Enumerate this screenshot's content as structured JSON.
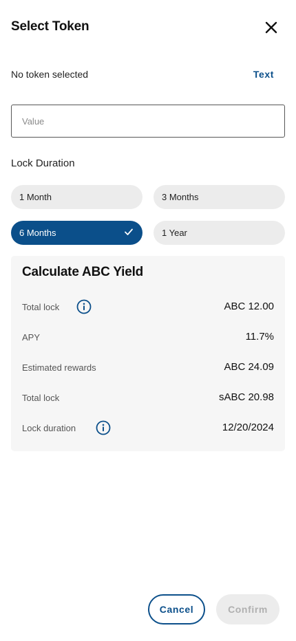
{
  "header": {
    "title": "Select Token",
    "close_icon": "close-icon"
  },
  "token": {
    "status": "No token selected",
    "link_label": "Text"
  },
  "value_input": {
    "placeholder": "Value",
    "value": ""
  },
  "lock_duration": {
    "label": "Lock Duration",
    "options": [
      {
        "label": "1 Month",
        "selected": false
      },
      {
        "label": "3 Months",
        "selected": false
      },
      {
        "label": "6 Months",
        "selected": true
      },
      {
        "label": "1 Year",
        "selected": false
      }
    ],
    "check_icon": "check-icon"
  },
  "yield_card": {
    "title": "Calculate ABC Yield",
    "rows": [
      {
        "label": "Total lock",
        "value": "ABC 12.00",
        "info_icon": true
      },
      {
        "label": "APY",
        "value": "11.7%",
        "info_icon": false
      },
      {
        "label": "Estimated rewards",
        "value": "ABC 24.09",
        "info_icon": false
      },
      {
        "label": "Total lock",
        "value": "sABC 20.98",
        "info_icon": false
      },
      {
        "label": "Lock duration",
        "value": "12/20/2024",
        "info_icon": true
      }
    ]
  },
  "footer": {
    "cancel_label": "Cancel",
    "confirm_label": "Confirm",
    "confirm_enabled": false
  },
  "colors": {
    "accent": "#0b4f8a",
    "pill_bg": "#ececec",
    "card_bg": "#f6f6f6",
    "disabled_text": "#b0b0b0"
  }
}
